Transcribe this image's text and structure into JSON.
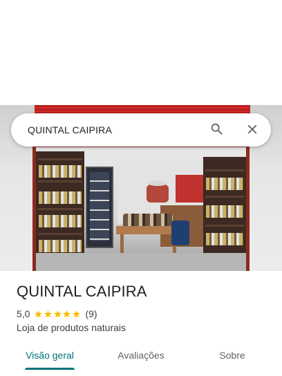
{
  "search": {
    "query": "QUINTAL CAIPIRA",
    "search_icon": "search-icon",
    "close_icon": "close-icon"
  },
  "place": {
    "name": "QUINTAL CAIPIRA",
    "rating": "5,0",
    "rating_stars": 5,
    "review_count": "(9)",
    "category": "Loja de produtos naturais",
    "photo": "storefront-photo"
  },
  "tabs": [
    {
      "label": "Visão geral",
      "active": true
    },
    {
      "label": "Avaliações",
      "active": false
    },
    {
      "label": "Sobre",
      "active": false
    }
  ],
  "colors": {
    "accent": "#00737a",
    "star": "#fbbc04",
    "text_primary": "#202124",
    "text_secondary": "#3c4043"
  }
}
